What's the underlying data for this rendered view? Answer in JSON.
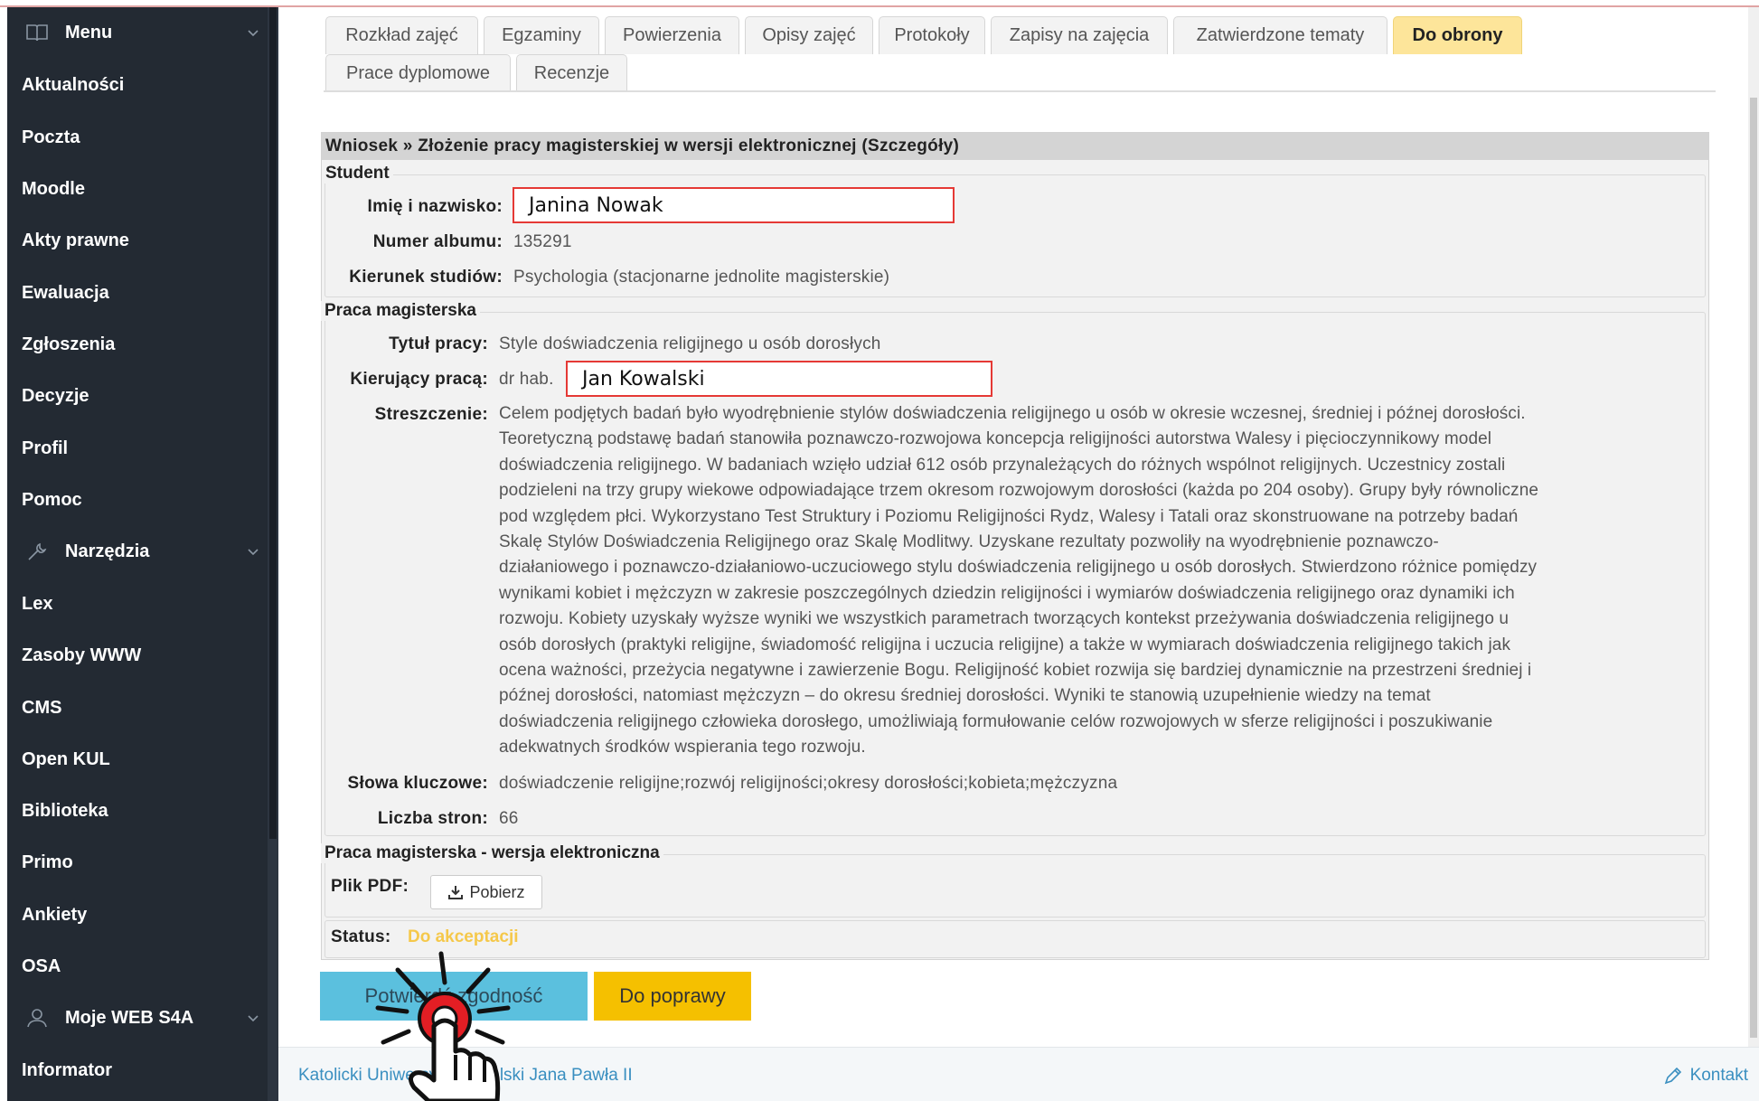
{
  "sidebar": {
    "items": [
      {
        "label": "Menu",
        "type": "group"
      },
      {
        "label": "Aktualności"
      },
      {
        "label": "Poczta"
      },
      {
        "label": "Moodle"
      },
      {
        "label": "Akty prawne"
      },
      {
        "label": "Ewaluacja"
      },
      {
        "label": "Zgłoszenia"
      },
      {
        "label": "Decyzje"
      },
      {
        "label": "Profil"
      },
      {
        "label": "Pomoc"
      },
      {
        "label": "Narzędzia",
        "type": "group"
      },
      {
        "label": "Lex"
      },
      {
        "label": "Zasoby WWW"
      },
      {
        "label": "CMS"
      },
      {
        "label": "Open KUL"
      },
      {
        "label": "Biblioteka"
      },
      {
        "label": "Primo"
      },
      {
        "label": "Ankiety"
      },
      {
        "label": "OSA"
      },
      {
        "label": "Moje WEB S4A",
        "type": "group"
      },
      {
        "label": "Informator"
      }
    ]
  },
  "tabs": [
    {
      "label": "Rozkład zajęć"
    },
    {
      "label": "Egzaminy"
    },
    {
      "label": "Powierzenia"
    },
    {
      "label": "Opisy zajęć"
    },
    {
      "label": "Protokoły"
    },
    {
      "label": "Zapisy na zajęcia"
    },
    {
      "label": "Zatwierdzone tematy"
    },
    {
      "label": "Do obrony",
      "active": true
    },
    {
      "label": "Prace dyplomowe"
    },
    {
      "label": "Recenzje"
    }
  ],
  "panel": {
    "heading": "Wniosek » Złożenie pracy magisterskiej w wersji elektronicznej (Szczegóły)",
    "student": {
      "legend": "Student",
      "name_label": "Imię i nazwisko:",
      "name_value": "Janina Nowak",
      "album_label": "Numer albumu:",
      "album_value": "135291",
      "course_label": "Kierunek studiów:",
      "course_value": "Psychologia (stacjonarne jednolite magisterskie)"
    },
    "thesis": {
      "legend": "Praca magisterska",
      "title_label": "Tytuł pracy:",
      "title_value": "Style doświadczenia religijnego u osób dorosłych",
      "supervisor_label": "Kierujący pracą:",
      "supervisor_prefix": "dr hab.",
      "supervisor_value": "Jan Kowalski",
      "abstract_label": "Streszczenie:",
      "abstract_lines": [
        "Celem podjętych badań było wyodrębnienie stylów doświadczenia religijnego u osób w okresie wczesnej, średniej i późnej dorosłości.",
        "Teoretyczną podstawę badań stanowiła poznawczo-rozwojowa koncepcja religijności autorstwa Walesy i pięcioczynnikowy model",
        "doświadczenia religijnego. W badaniach wzięło udział 612 osób przynależących do różnych wspólnot religijnych. Uczestnicy zostali",
        "podzieleni na trzy grupy wiekowe odpowiadające trzem okresom rozwojowym dorosłości (każda po 204 osoby). Grupy były równoliczne",
        "pod względem płci. Wykorzystano Test Struktury i Poziomu Religijności Rydz, Walesy i Tatali oraz skonstruowane na potrzeby badań",
        "Skalę Stylów Doświadczenia Religijnego oraz Skalę Modlitwy. Uzyskane rezultaty pozwoliły na wyodrębnienie poznawczo-",
        "działaniowego i poznawczo-działaniowo-uczuciowego stylu doświadczenia religijnego u osób dorosłych. Stwierdzono różnice pomiędzy",
        "wynikami kobiet i mężczyzn w zakresie poszczególnych dziedzin religijności i wymiarów doświadczenia religijnego oraz dynamiki ich",
        "rozwoju. Kobiety uzyskały wyższe wyniki we wszystkich parametrach tworzących kontekst przeżywania doświadczenia religijnego u",
        "osób dorosłych (praktyki religijne, świadomość religijna i uczucia religijne) a także w wymiarach doświadczenia religijnego takich jak",
        "ocena ważności, przeżycia negatywne i zawierzenie Bogu. Religijność kobiet rozwija się bardziej dynamicznie na przestrzeni średniej i",
        "późnej dorosłości, natomiast mężczyzn – do okresu średniej dorosłości. Wyniki te stanowią uzupełnienie wiedzy na temat",
        "doświadczenia religijnego człowieka dorosłego, umożliwiają formułowanie celów rozwojowych w sferze religijności i poszukiwanie",
        "adekwatnych środków wspierania tego rozwoju."
      ],
      "keywords_label": "Słowa kluczowe:",
      "keywords_value": "doświadczenie religijne;rozwój religijności;okresy dorosłości;kobieta;mężczyzna",
      "pages_label": "Liczba stron:",
      "pages_value": "66"
    },
    "electronic": {
      "legend": "Praca magisterska - wersja elektroniczna",
      "pdf_label": "Plik PDF:",
      "download_label": "Pobierz"
    },
    "status_label": "Status:",
    "status_value": "Do akceptacji"
  },
  "actions": {
    "confirm_label": "Potwierdź zgodność",
    "fix_label": "Do poprawy"
  },
  "footer": {
    "university": "Katolicki Uniwersytet Lubelski Jana Pawła II",
    "contact": "Kontakt"
  },
  "colors": {
    "sidebar_bg": "#232a33",
    "active_tab": "#fde59a",
    "confirm_button": "#5bc0de",
    "fix_button": "#f5c000",
    "status": "#f5c84a",
    "highlight_box": "#e53935",
    "link": "#3a8fc0"
  }
}
